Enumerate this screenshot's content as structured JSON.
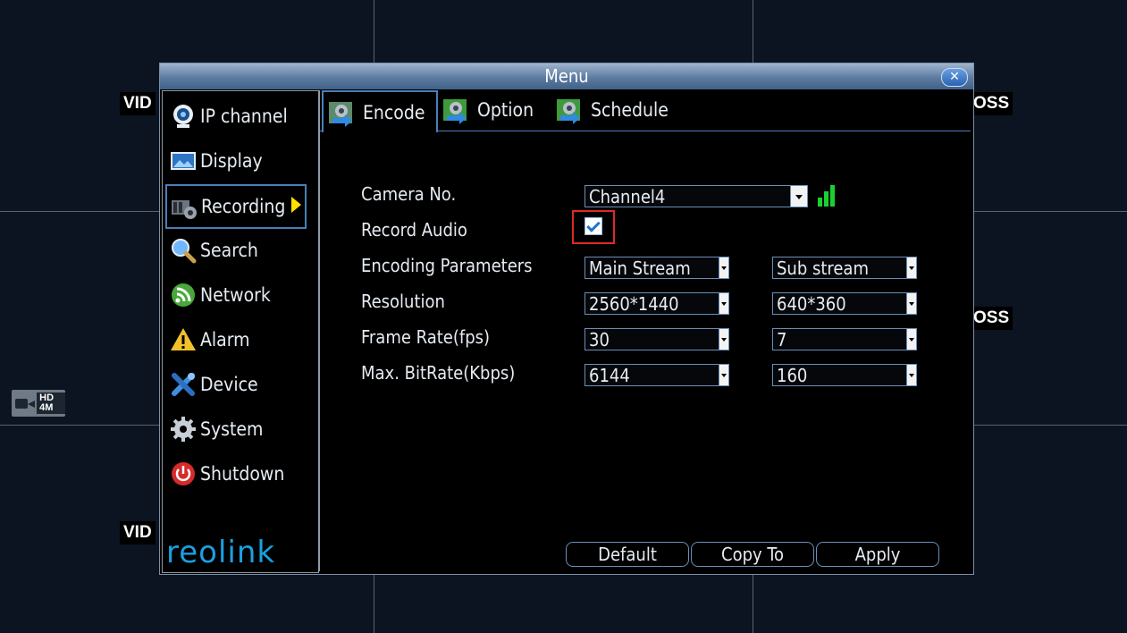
{
  "background": {
    "tags": [
      "VID",
      "OSS",
      "OSS",
      "VID"
    ],
    "hd_badge": "HD 4M"
  },
  "window": {
    "title": "Menu",
    "close_label": "✕"
  },
  "sidebar": {
    "items": [
      {
        "label": "IP channel",
        "icon": "webcam-icon"
      },
      {
        "label": "Display",
        "icon": "display-icon"
      },
      {
        "label": "Recording",
        "icon": "recording-icon",
        "active": true
      },
      {
        "label": "Search",
        "icon": "magnifier-icon"
      },
      {
        "label": "Network",
        "icon": "network-icon"
      },
      {
        "label": "Alarm",
        "icon": "warning-icon"
      },
      {
        "label": "Device",
        "icon": "tools-icon"
      },
      {
        "label": "System",
        "icon": "gear-icon"
      },
      {
        "label": "Shutdown",
        "icon": "power-icon"
      }
    ],
    "logo": "reolink"
  },
  "tabs": [
    {
      "label": "Encode",
      "active": true
    },
    {
      "label": "Option"
    },
    {
      "label": "Schedule"
    }
  ],
  "form": {
    "camera_no_label": "Camera No.",
    "camera_no_value": "Channel4",
    "record_audio_label": "Record Audio",
    "record_audio_checked": true,
    "encoding_label": "Encoding Parameters",
    "encoding_main": "Main Stream",
    "encoding_sub": "Sub stream",
    "resolution_label": "Resolution",
    "resolution_main": "2560*1440",
    "resolution_sub": "640*360",
    "framerate_label": "Frame Rate(fps)",
    "framerate_main": "30",
    "framerate_sub": "7",
    "bitrate_label": "Max. BitRate(Kbps)",
    "bitrate_main": "6144",
    "bitrate_sub": "160"
  },
  "buttons": {
    "default": "Default",
    "copy_to": "Copy To",
    "apply": "Apply"
  },
  "colors": {
    "accent": "#4a7fb8",
    "highlight": "#e02828",
    "signal": "#19d12e"
  }
}
